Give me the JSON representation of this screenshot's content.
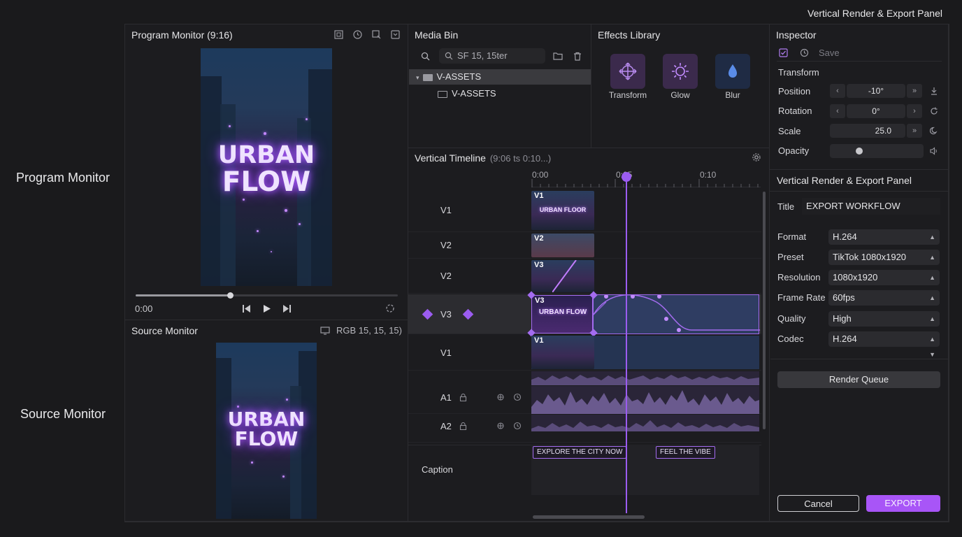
{
  "app": {
    "title": "Vertical Render & Export Panel"
  },
  "side_labels": {
    "program": "Program Monitor",
    "source": "Source Monitor"
  },
  "program_monitor": {
    "title": "Program Monitor (9:16)",
    "video_line1": "URBAN",
    "video_line2": "FLOW",
    "timecode": "0:00",
    "progress": 0.36,
    "icons": [
      "safe-margins-icon",
      "clock-icon",
      "export-frame-icon",
      "settings-icon"
    ]
  },
  "source_monitor": {
    "title": "Source Monitor",
    "color_readout": "RGB 15, 15, 15)",
    "video_line1": "URBAN",
    "video_line2": "FLOW"
  },
  "media_bin": {
    "title": "Media Bin",
    "search_value": "SF 15, 15ter",
    "tree": [
      {
        "label": "V-ASSETS",
        "expanded": true
      },
      {
        "label": "V-ASSETS",
        "child": true
      }
    ]
  },
  "effects_library": {
    "title": "Effects Library",
    "items": [
      {
        "label": "Transform",
        "icon": "transform-icon"
      },
      {
        "label": "Glow",
        "icon": "glow-icon"
      },
      {
        "label": "Blur",
        "icon": "blur-icon"
      }
    ]
  },
  "timeline": {
    "title": "Vertical Timeline",
    "range": "(9:06 ts 0:10...)",
    "ruler": [
      "0:00",
      "0:05",
      "0:10"
    ],
    "tracks": [
      {
        "label": "V1",
        "clip_tag": "V1",
        "clip_text": "URBAN FLOOR"
      },
      {
        "label": "V2",
        "clip_tag": "V2"
      },
      {
        "label": "V2",
        "clip_tag": "V3"
      },
      {
        "label": "V3",
        "clip_tag": "V3",
        "clip_text": "URBAN FLOW",
        "selected": true
      },
      {
        "label": "V1",
        "clip_tag": "V1"
      },
      {
        "label": "A1"
      },
      {
        "label": "A2"
      }
    ],
    "caption_label": "Caption",
    "captions": [
      "EXPLORE THE CITY NOW",
      "FEEL THE VIBE"
    ]
  },
  "inspector": {
    "title": "Inspector",
    "save_label": "Save",
    "section": "Transform",
    "position_label": "Position",
    "position_value": "-10°",
    "rotation_label": "Rotation",
    "rotation_value": "0°",
    "scale_label": "Scale",
    "scale_value": "25.0",
    "opacity_label": "Opacity",
    "opacity_level": 0.3
  },
  "export_panel": {
    "title": "Vertical Render & Export Panel",
    "title_label": "Title",
    "title_value": "EXPORT WORKFLOW",
    "format_label": "Format",
    "format_value": "H.264",
    "preset_label": "Preset",
    "preset_value": "TikTok 1080x1920",
    "resolution_label": "Resolution",
    "resolution_value": "1080x1920",
    "framerate_label": "Frame Rate",
    "framerate_value": "60fps",
    "quality_label": "Quality",
    "quality_value": "High",
    "codec_label": "Codec",
    "codec_value": "H.264",
    "render_queue_label": "Render Queue",
    "cancel_label": "Cancel",
    "export_label": "EXPORT"
  },
  "colors": {
    "accent": "#a855f7",
    "playhead": "#9b5cf0",
    "bg": "#1a1a1c"
  }
}
